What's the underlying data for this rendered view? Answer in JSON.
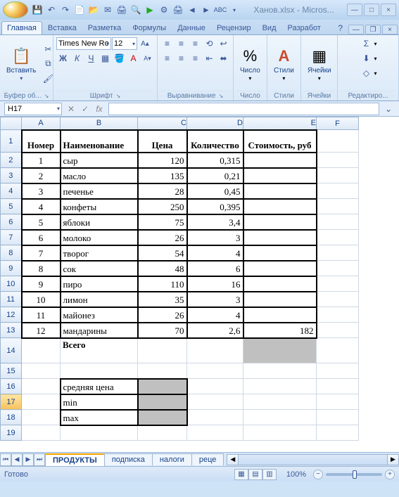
{
  "title": "Ханов.xlsx - Micros...",
  "tabs": [
    "Главная",
    "Вставка",
    "Разметка",
    "Формулы",
    "Данные",
    "Рецензир",
    "Вид",
    "Разработ"
  ],
  "active_tab": 0,
  "ribbon": {
    "groups": {
      "clipboard": {
        "label": "Буфер об...",
        "paste": "Вставить"
      },
      "font": {
        "label": "Шрифт",
        "font": "Times New Ro",
        "size": "12"
      },
      "alignment": {
        "label": "Выравнивание"
      },
      "number": {
        "label": "Число"
      },
      "styles": {
        "label": "Стили"
      },
      "cells": {
        "label": "Ячейки"
      },
      "editing": {
        "label": "Редактиро..."
      }
    }
  },
  "name_box": "H17",
  "formula": "",
  "columns": [
    "A",
    "B",
    "C",
    "D",
    "E",
    "F"
  ],
  "headers": {
    "A": "Номер",
    "B": "Наименование",
    "C": "Цена",
    "D": "Количество",
    "E": "Стоимость, руб"
  },
  "rows": [
    {
      "n": 1,
      "A": "1",
      "B": "сыр",
      "C": "120",
      "D": "0,315",
      "E": ""
    },
    {
      "n": 2,
      "A": "2",
      "B": "масло",
      "C": "135",
      "D": "0,21",
      "E": ""
    },
    {
      "n": 3,
      "A": "3",
      "B": "печенье",
      "C": "28",
      "D": "0,45",
      "E": ""
    },
    {
      "n": 4,
      "A": "4",
      "B": "конфеты",
      "C": "250",
      "D": "0,395",
      "E": ""
    },
    {
      "n": 5,
      "A": "5",
      "B": "яблоки",
      "C": "75",
      "D": "3,4",
      "E": ""
    },
    {
      "n": 6,
      "A": "6",
      "B": "молоко",
      "C": "26",
      "D": "3",
      "E": ""
    },
    {
      "n": 7,
      "A": "7",
      "B": "творог",
      "C": "54",
      "D": "4",
      "E": ""
    },
    {
      "n": 8,
      "A": "8",
      "B": "сок",
      "C": "48",
      "D": "6",
      "E": ""
    },
    {
      "n": 9,
      "A": "9",
      "B": "пиро",
      "C": "110",
      "D": "16",
      "E": ""
    },
    {
      "n": 10,
      "A": "10",
      "B": "лимон",
      "C": "35",
      "D": "3",
      "E": ""
    },
    {
      "n": 11,
      "A": "11",
      "B": "майонез",
      "C": "26",
      "D": "4",
      "E": ""
    },
    {
      "n": 12,
      "A": "12",
      "B": "мандарины",
      "C": "70",
      "D": "2,6",
      "E": "182"
    }
  ],
  "total_label": "Всего",
  "stats": {
    "avg": "средняя цена",
    "min": "min",
    "max": "max"
  },
  "sheet_tabs": [
    "ПРОДУКТЫ",
    "подписка",
    "налоги",
    "реце"
  ],
  "active_sheet": 0,
  "status_ready": "Готово",
  "zoom": "100%"
}
